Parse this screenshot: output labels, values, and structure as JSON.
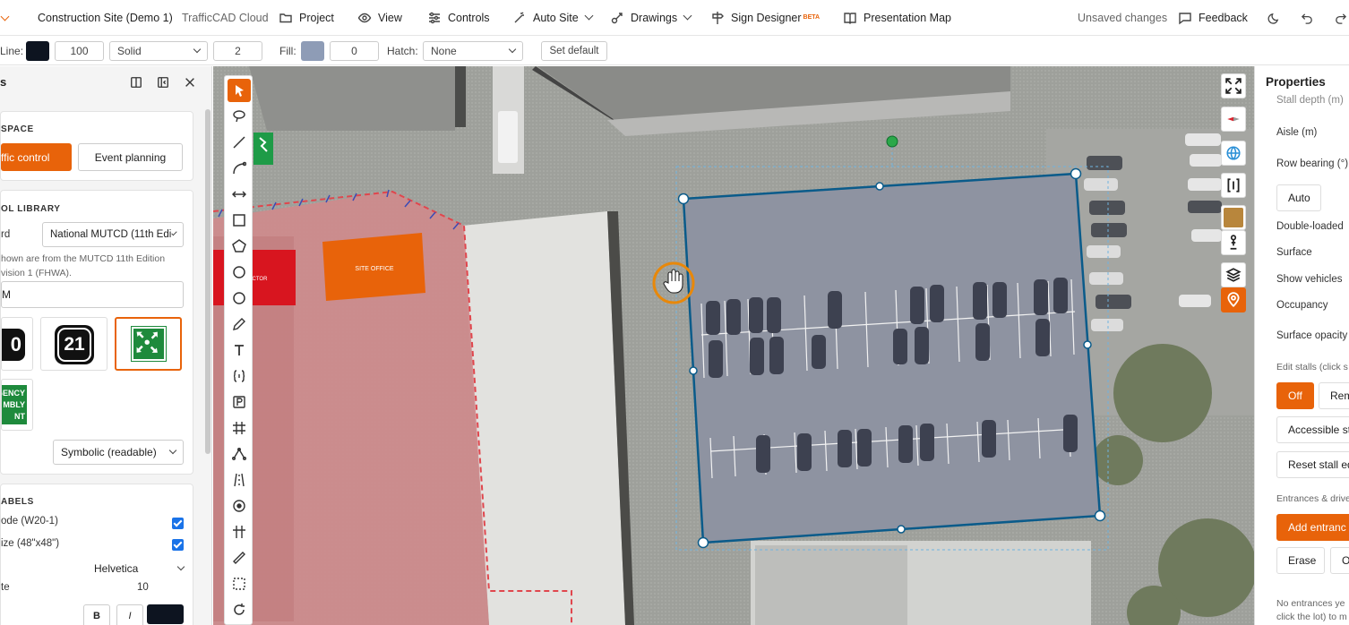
{
  "topbar": {
    "site_name": "Construction Site (Demo 1)",
    "product": "TrafficCAD Cloud",
    "menu": {
      "project": "Project",
      "view": "View",
      "controls": "Controls",
      "auto_site": "Auto Site",
      "drawings": "Drawings",
      "sign_designer": "Sign Designer",
      "sign_designer_badge": "BETA",
      "presentation_map": "Presentation Map"
    },
    "status": "Unsaved changes",
    "feedback": "Feedback"
  },
  "stylebar": {
    "line_label": "Line:",
    "line_color": "#0d1420",
    "line_width": "100",
    "line_style": "Solid",
    "line_weight": "2",
    "fill_label": "Fill:",
    "fill_color": "#8e9cb6",
    "fill_opacity": "0",
    "hatch_label": "Hatch:",
    "hatch_value": "None",
    "set_default": "Set default"
  },
  "leftpanel": {
    "header_title": "s",
    "workspace": {
      "title": "SPACE",
      "btn_traffic": "ffic control",
      "btn_event": "Event planning"
    },
    "library": {
      "title": "OL LIBRARY",
      "standard_label": "rd",
      "standard_value": "National MUTCD (11th Edi",
      "note_line1": "hown are from the MUTCD 11th Edition",
      "note_line2": "vision 1 (FHWA).",
      "search_value": "M",
      "tiles": [
        {
          "text": "0"
        },
        {
          "text": "21"
        },
        {
          "text": ""
        }
      ],
      "sign_line1": "GENCY",
      "sign_line2": "MBLY",
      "sign_line3": "NT",
      "render_mode": "Symbolic (readable)"
    },
    "labels": {
      "title": "ABELS",
      "code_label": "ode (W20-1)",
      "size_label": "ize (48\"x48\")",
      "font_value": "Helvetica",
      "font_size_label": "te",
      "font_size_value": "10",
      "bold": "B",
      "italic": "I",
      "text_color": "#0d1420"
    }
  },
  "map": {
    "site_office_label": "SITE OFFICE",
    "red_label": "TRACTOR",
    "accent_color": "#e8630a",
    "zone_color": "#e05860",
    "lot_fill": "#8e93a1",
    "lot_stroke": "#0a5b8a"
  },
  "properties": {
    "title": "Properties",
    "stall_depth": "Stall depth (m)",
    "aisle": "Aisle (m)",
    "row_bearing": "Row bearing (°)",
    "auto_btn": "Auto",
    "double_loaded": "Double-loaded",
    "surface": "Surface",
    "show_vehicles": "Show vehicles",
    "occupancy": "Occupancy",
    "surface_opacity": "Surface opacity",
    "edit_stalls": "Edit stalls (click s",
    "off_btn": "Off",
    "remove_btn": "Rem",
    "accessible_btn": "Accessible st",
    "reset_btn": "Reset stall ed",
    "entrances_label": "Entrances & drive",
    "add_entrance_btn": "Add entranc",
    "erase_btn": "Erase",
    "other_btn": "O",
    "note_line1": "No entrances ye",
    "note_line2": "click the lot) to m"
  }
}
